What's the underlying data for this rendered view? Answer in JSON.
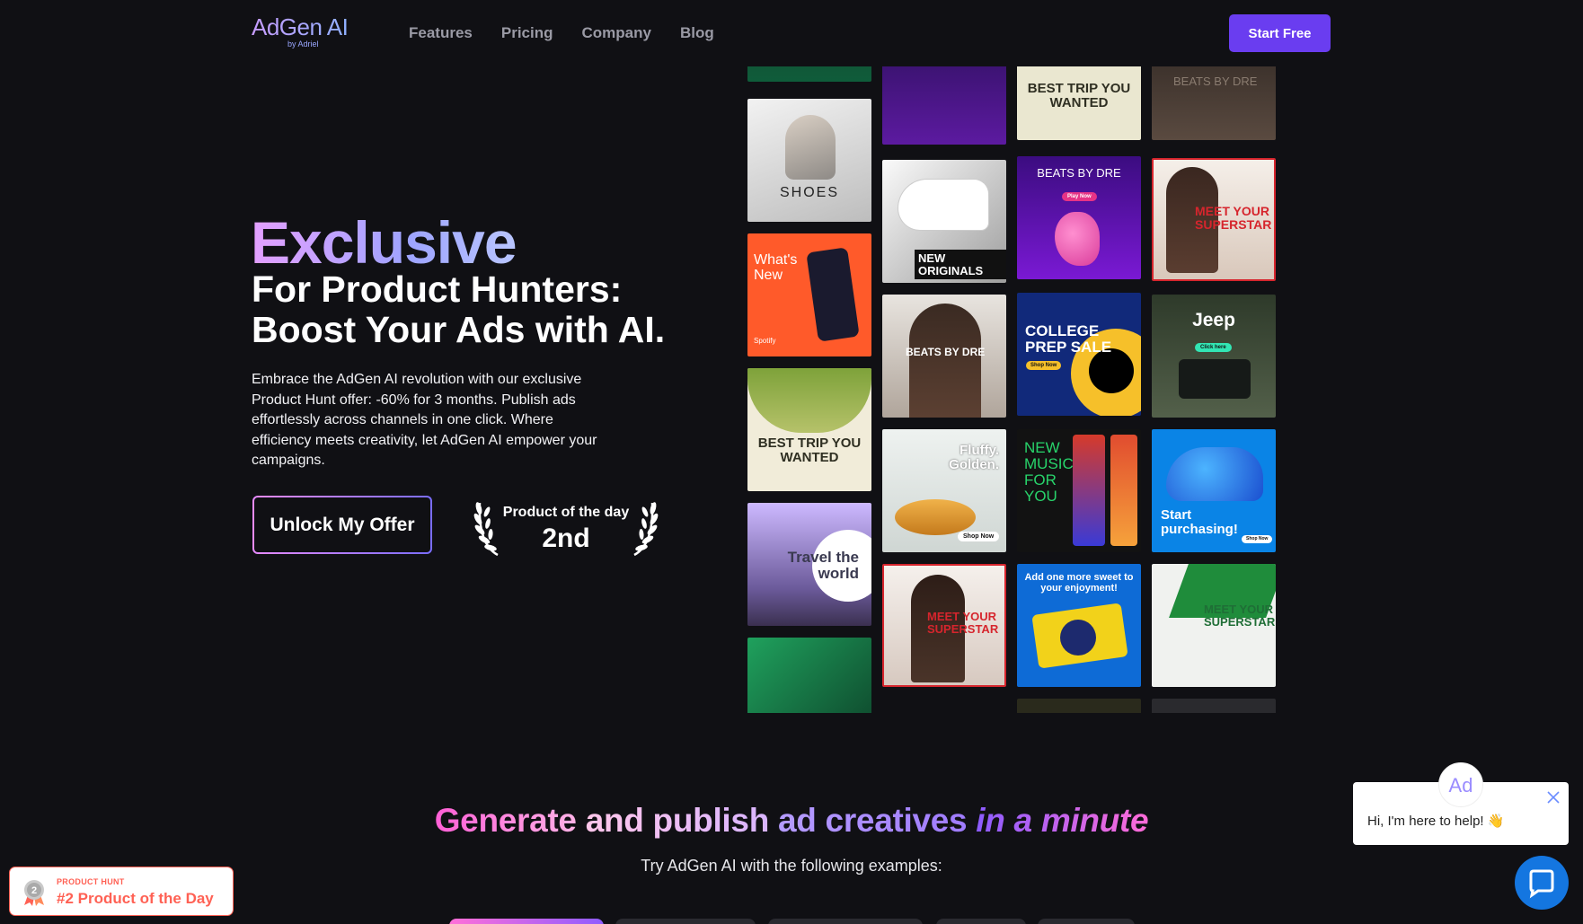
{
  "nav": {
    "logo": "AdGen AI",
    "logo_sub": "by Adriel",
    "links": [
      "Features",
      "Pricing",
      "Company",
      "Blog"
    ],
    "cta": "Start Free"
  },
  "hero": {
    "eyebrow": "Exclusive",
    "title_line1": "For Product Hunters:",
    "title_line2": "Boost Your Ads with AI.",
    "description": "Embrace the AdGen AI revolution with our exclusive Product Hunt offer: -60% for 3 months. Publish ads effortlessly across channels in one click. Where efficiency meets creativity, let AdGen AI empower your campaigns.",
    "button": "Unlock My Offer",
    "award_label": "Product of the day",
    "award_rank": "2nd"
  },
  "ads": {
    "shoes": "SHOES",
    "whats_new": "What's New",
    "best_trip": "BEST TRIP YOU WANTED",
    "travel": "Travel the world",
    "new_originals": "NEW ORIGINALS",
    "beats_by_dre": "BEATS BY DRE",
    "fluffy": "Fluffy. Golden.",
    "meet_superstar": "MEET YOUR SUPERSTAR",
    "college": "COLLEGE PREP SALE",
    "new_music": "NEW MUSIC FOR YOU",
    "oreo": "Add one more sweet to your enjoyment!",
    "jeep": "Jeep",
    "start_purchasing": "Start purchasing!",
    "shop_now": "Shop Now",
    "play_now": "Play Now",
    "click_here": "Click here",
    "spotify": "Spotify"
  },
  "section2": {
    "title_part1": "Generate",
    "title_part2": "and publish",
    "title_part3": "ad creatives",
    "title_part4": "in a minute",
    "subtitle": "Try AdGen AI with the following examples:"
  },
  "ph_badge": {
    "small": "PRODUCT HUNT",
    "big": "#2 Product of the Day",
    "medal": "2"
  },
  "chat": {
    "avatar": "Ad",
    "message": "Hi, I'm here to help! 👋"
  }
}
